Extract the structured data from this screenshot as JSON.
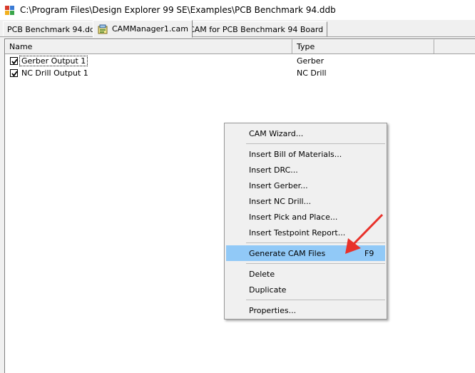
{
  "window": {
    "title": "C:\\Program Files\\Design Explorer 99 SE\\Examples\\PCB Benchmark 94.ddb",
    "app_icon": "design-explorer-icon"
  },
  "tabs": [
    {
      "label": "PCB Benchmark 94.ddb",
      "active": false
    },
    {
      "label": "CAMManager1.cam",
      "active": true,
      "icon": "cam-document-icon"
    },
    {
      "label": "CAM for PCB Benchmark 94 Board",
      "active": false
    }
  ],
  "list": {
    "columns": [
      "Name",
      "Type"
    ],
    "rows": [
      {
        "name": "Gerber Output 1",
        "type": "Gerber",
        "checked": true
      },
      {
        "name": "NC Drill Output 1",
        "type": "NC Drill",
        "checked": true
      }
    ]
  },
  "context_menu": {
    "items": [
      {
        "label": "CAM Wizard...",
        "shortcut": ""
      },
      {
        "label": "Insert Bill of Materials...",
        "shortcut": ""
      },
      {
        "label": "Insert DRC...",
        "shortcut": ""
      },
      {
        "label": "Insert Gerber...",
        "shortcut": ""
      },
      {
        "label": "Insert NC Drill...",
        "shortcut": ""
      },
      {
        "label": "Insert Pick and Place...",
        "shortcut": ""
      },
      {
        "label": "Insert Testpoint Report...",
        "shortcut": ""
      },
      {
        "label": "Generate CAM Files",
        "shortcut": "F9",
        "highlighted": true
      },
      {
        "label": "Delete",
        "shortcut": ""
      },
      {
        "label": "Duplicate",
        "shortcut": ""
      },
      {
        "label": "Properties...",
        "shortcut": ""
      }
    ]
  },
  "colors": {
    "highlight": "#91c9f7",
    "annotation_arrow": "#e8322b"
  }
}
